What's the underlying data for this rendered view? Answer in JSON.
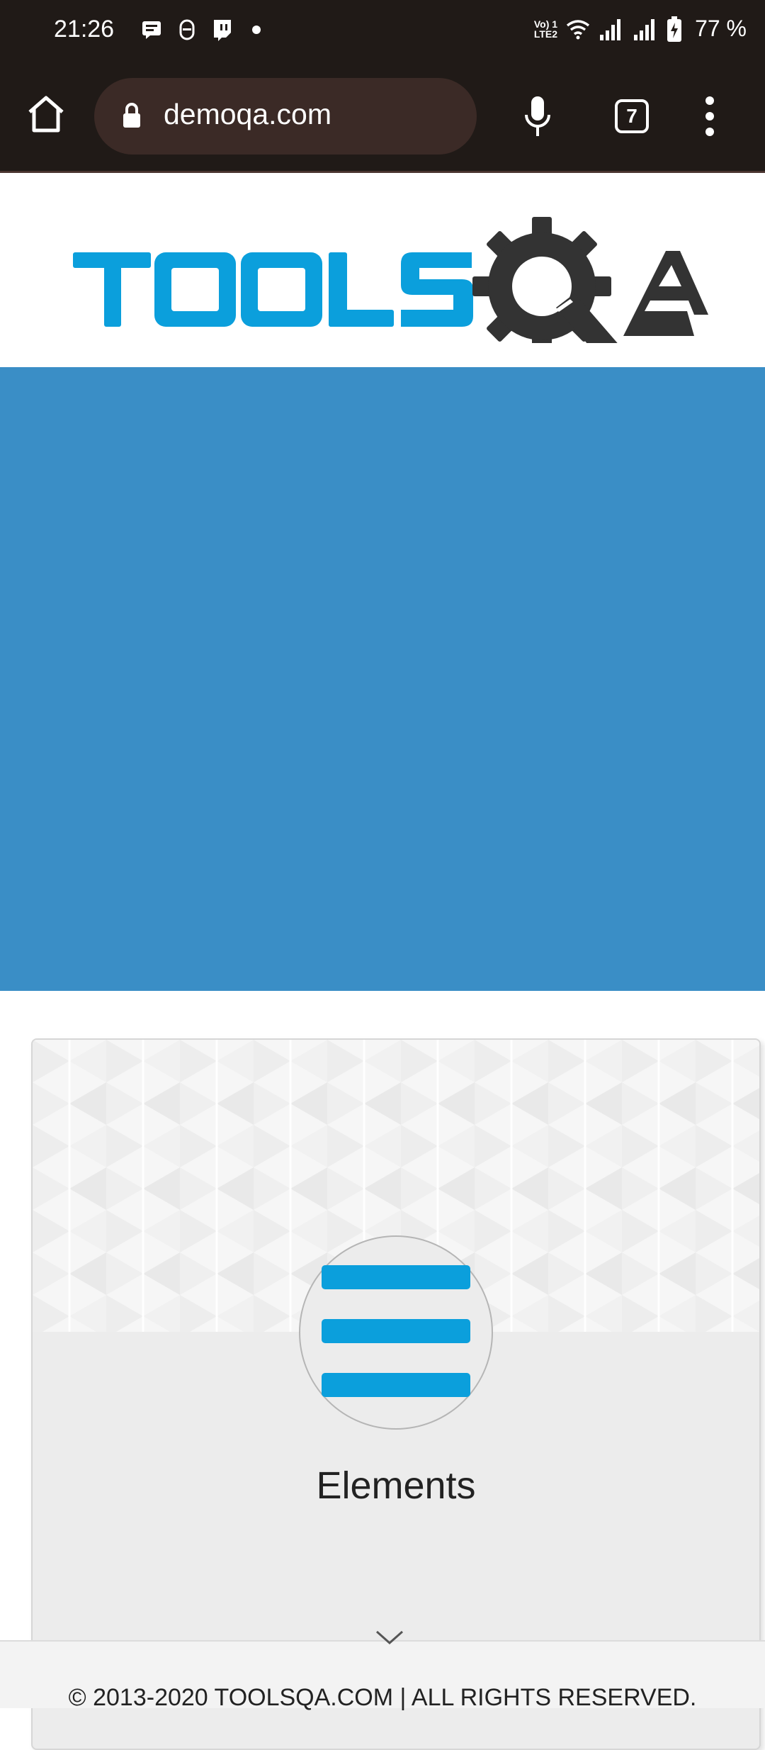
{
  "status_bar": {
    "time": "21:26",
    "left_icons": [
      "message-icon",
      "app-icon",
      "twitch-icon",
      "dot-icon"
    ],
    "volte_label": "Vo) 1\nLTE2",
    "battery_percent": "77 %"
  },
  "browser": {
    "url": "demoqa.com",
    "tab_count": "7"
  },
  "logo": {
    "alt": "TOOLSQA"
  },
  "colors": {
    "banner": "#3a8ec6",
    "brand_blue": "#0b9fdc",
    "dark": "#201a17"
  },
  "card": {
    "title": "Elements",
    "icon": "list-lines-icon"
  },
  "footer": {
    "text": "© 2013-2020 TOOLSQA.COM | ALL RIGHTS RESERVED."
  }
}
